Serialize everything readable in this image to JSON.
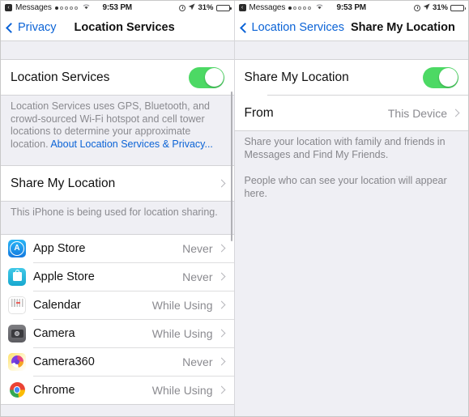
{
  "status_bar": {
    "back_badge": "‹",
    "carrier": "Messages",
    "signal_dots_total": 5,
    "signal_dots_filled": 1,
    "wifi_icon": "wifi-icon",
    "time": "9:53 PM",
    "alarm_icon": "alarm-clock-icon",
    "location_icon": "location-arrow-icon",
    "battery_percent": "31%",
    "battery_level": 31
  },
  "left_pane": {
    "nav": {
      "back_label": "Privacy",
      "title": "Location Services"
    },
    "location_services_row": {
      "label": "Location Services",
      "toggle_on": true
    },
    "location_services_footer": {
      "text": "Location Services uses GPS, Bluetooth, and crowd-sourced Wi-Fi hotspot and cell tower locations to determine your approximate location. ",
      "link": "About Location Services & Privacy..."
    },
    "share_my_location_row": {
      "label": "Share My Location"
    },
    "share_footer": "This iPhone is being used for location sharing.",
    "apps": [
      {
        "name": "App Store",
        "value": "Never",
        "icon": "app-store-icon"
      },
      {
        "name": "Apple Store",
        "value": "Never",
        "icon": "apple-store-icon"
      },
      {
        "name": "Calendar",
        "value": "While Using",
        "icon": "calendar-icon"
      },
      {
        "name": "Camera",
        "value": "While Using",
        "icon": "camera-icon"
      },
      {
        "name": "Camera360",
        "value": "Never",
        "icon": "camera360-icon"
      },
      {
        "name": "Chrome",
        "value": "While Using",
        "icon": "chrome-icon"
      }
    ]
  },
  "right_pane": {
    "nav": {
      "back_label": "Location Services",
      "title": "Share My Location"
    },
    "share_my_location_row": {
      "label": "Share My Location",
      "toggle_on": true
    },
    "from_row": {
      "label": "From",
      "value": "This Device"
    },
    "footer_1": "Share your location with family and friends in Messages and Find My Friends.",
    "footer_2": "People who can see your location will appear here."
  },
  "colors": {
    "toggle_on": "#4CD964",
    "link": "#0B63D6",
    "background": "#EFEFF4",
    "value_text": "#8A8A8F"
  }
}
